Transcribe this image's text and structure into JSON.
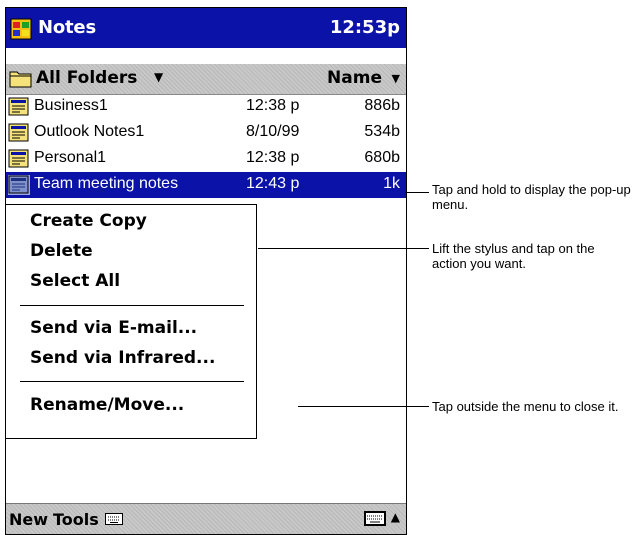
{
  "titlebar": {
    "app_title": "Notes",
    "clock": "12:53p"
  },
  "folderbar": {
    "folder": "All Folders",
    "sort": "Name"
  },
  "files": [
    {
      "name": "Business1",
      "time": "12:38 p",
      "size": "886b"
    },
    {
      "name": "Outlook Notes1",
      "time": "8/10/99",
      "size": "534b"
    },
    {
      "name": "Personal1",
      "time": "12:38 p",
      "size": "680b"
    },
    {
      "name": "Team meeting notes",
      "time": "12:43 p",
      "size": "1k"
    }
  ],
  "popup_menu": [
    "Create Copy",
    "Delete",
    "Select All",
    "Send via E-mail...",
    "Send via Infrared...",
    "Rename/Move..."
  ],
  "bottombar": {
    "new_label": "New",
    "tools_label": "Tools"
  },
  "callouts": {
    "tap_hold": "Tap and hold to display the pop-up menu.",
    "lift_stylus": "Lift the stylus and tap on the action you want.",
    "tap_outside": "Tap outside the menu to close it."
  },
  "colors": {
    "title_bg": "#0a12a8",
    "selection_bg": "#0a12a8"
  }
}
